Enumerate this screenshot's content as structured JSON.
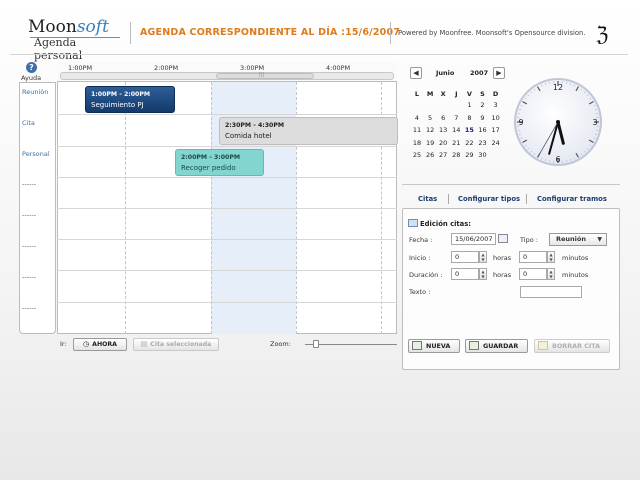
{
  "header": {
    "logo_main_a": "Moon",
    "logo_main_b": "soft",
    "logo_sub": "Agenda personal",
    "title": "AGENDA CORRESPONDIENTE AL DÍA :15/6/2007",
    "powered_by": "Powered by Moonfree. Moonsoft's Opensource division.",
    "moonfree_glyph": "ℨ"
  },
  "sidebar": {
    "help_icon": "?",
    "help_label": "Ayuda",
    "rows": [
      "Reunión",
      "Cita",
      "Personal",
      "------",
      "------",
      "------",
      "------",
      "------"
    ]
  },
  "timeline": {
    "times": [
      "1:00PM",
      "2:00PM",
      "3:00PM",
      "4:00PM"
    ]
  },
  "events": [
    {
      "time": "1:00PM - 2:00PM",
      "title": "Seguimiento PJ"
    },
    {
      "time": "2:30PM - 4:30PM",
      "title": "Comida hotel"
    },
    {
      "time": "2:00PM - 3:00PM",
      "title": "Recoger pedido"
    }
  ],
  "toolbar": {
    "ir_label": "Ir:",
    "ahora_label": "AHORA",
    "cita_sel_label": "Cita seleccionada",
    "zoom_label": "Zoom:"
  },
  "mini_calendar": {
    "prev": "◀",
    "next": "▶",
    "month": "Junio",
    "year": "2007",
    "weekdays": [
      "L",
      "M",
      "X",
      "J",
      "V",
      "S",
      "D"
    ],
    "weeks": [
      [
        "",
        "",
        "",
        "",
        "1",
        "2",
        "3"
      ],
      [
        "4",
        "5",
        "6",
        "7",
        "8",
        "9",
        "10"
      ],
      [
        "11",
        "12",
        "13",
        "14",
        "15",
        "16",
        "17"
      ],
      [
        "18",
        "19",
        "20",
        "21",
        "22",
        "23",
        "24"
      ],
      [
        "25",
        "26",
        "27",
        "28",
        "29",
        "30",
        ""
      ]
    ],
    "today": "15"
  },
  "clock": {
    "numbers": [
      "12",
      "3",
      "6",
      "9"
    ],
    "hour": 17,
    "minute": 32,
    "second": 35
  },
  "tabs": [
    "Citas",
    "Configurar tipos",
    "Configurar tramos"
  ],
  "editor": {
    "title": "Edición citas:",
    "fecha_label": "Fecha :",
    "fecha_value": "15/06/2007",
    "tipo_label": "Tipo :",
    "tipo_value": "Reunión",
    "inicio_label": "Inicio :",
    "inicio_horas": "0",
    "inicio_minutos": "0",
    "duracion_label": "Duración :",
    "duracion_horas": "0",
    "duracion_minutos": "0",
    "horas_label": "horas",
    "minutos_label": "minutos",
    "texto_label": "Texto :",
    "texto_value": "",
    "nueva_label": "NUEVA",
    "guardar_label": "GUARDAR",
    "borrar_label": "BORRAR CITA"
  }
}
